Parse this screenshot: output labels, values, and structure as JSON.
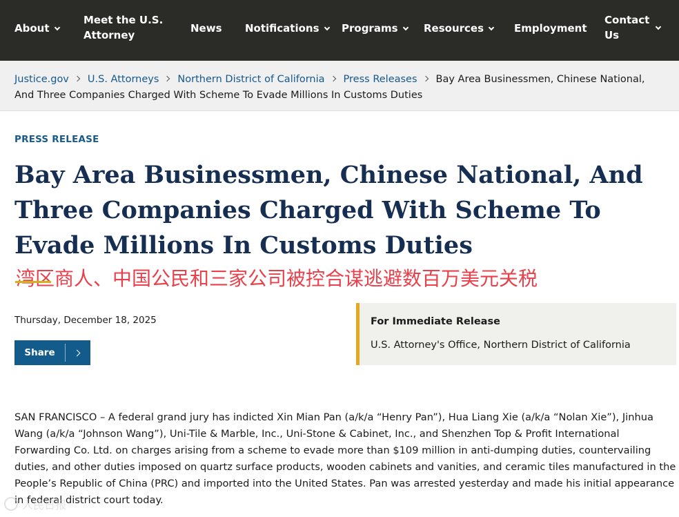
{
  "nav": {
    "items": [
      {
        "label": "About",
        "has_menu": true
      },
      {
        "label": "Meet the U.S.",
        "label2": "Attorney",
        "has_menu": false
      },
      {
        "label": "News",
        "has_menu": false
      },
      {
        "label": "Notifications",
        "has_menu": true
      },
      {
        "label": "Programs",
        "has_menu": true
      },
      {
        "label": "Resources",
        "has_menu": true
      },
      {
        "label": "Employment",
        "has_menu": false
      },
      {
        "label": "Contact",
        "label2": "Us",
        "has_menu": true
      }
    ]
  },
  "breadcrumb": {
    "links": [
      "Justice.gov",
      "U.S. Attorneys",
      "Northern District of California",
      "Press Releases"
    ],
    "current": "Bay Area Businessmen, Chinese National, And Three Companies Charged With Scheme To Evade Millions In Customs Duties"
  },
  "article": {
    "eyebrow": "PRESS RELEASE",
    "title": "Bay Area Businessmen, Chinese National, And Three Companies Charged With Scheme To Evade Millions In Customs Duties",
    "translated_title": "湾区商人、中国公民和三家公司被控合谋逃避数百万美元关税",
    "date": "Thursday, December 18, 2025",
    "share_label": "Share",
    "release_heading": "For Immediate Release",
    "release_office": "U.S. Attorney's Office, Northern District of California",
    "body": "SAN FRANCISCO – A federal grand jury has indicted Xin Mian Pan (a/k/a “Henry Pan”), Hua Liang Xie (a/k/a “Nolan Xie”), Jinhua Wang (a/k/a “Johnson Wang”), Uni-Tile & Marble, Inc., Uni-Stone & Cabinet, Inc., and Shenzhen Top & Profit International Forwarding Co. Ltd. on charges arising from a scheme to evade more than $109 million in anti-dumping duties, countervailing duties, and other duties imposed on quartz surface products, wooden cabinets and vanities, and ceramic tiles manufactured in the People’s Republic of China (PRC) and imported into the United States.  Pan was arrested yesterday and made his initial appearance in federal district court today."
  },
  "watermark": {
    "text": "人民日报"
  },
  "colors": {
    "nav_bg": "#2b2b27",
    "title": "#162e51",
    "link": "#14588e",
    "accent_gold": "#e5a823",
    "share_bg": "#135b8a",
    "translation": "#e8414b"
  }
}
